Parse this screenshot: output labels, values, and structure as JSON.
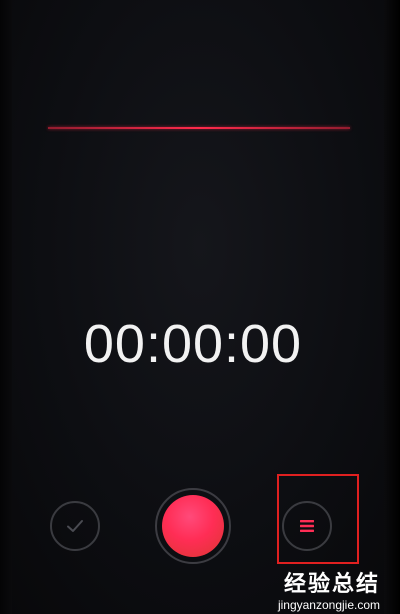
{
  "recorder": {
    "timer": "00:00:00"
  },
  "controls": {
    "done_icon": "check-icon",
    "record_icon": "record-dot",
    "list_icon": "list-icon"
  },
  "colors": {
    "accent": "#ff2d55",
    "highlight": "#e02020",
    "wave": "#ff2a4b"
  },
  "watermark": {
    "title_part1": "经验",
    "title_part2": "总结",
    "url": "jingyanzongjie.com"
  }
}
